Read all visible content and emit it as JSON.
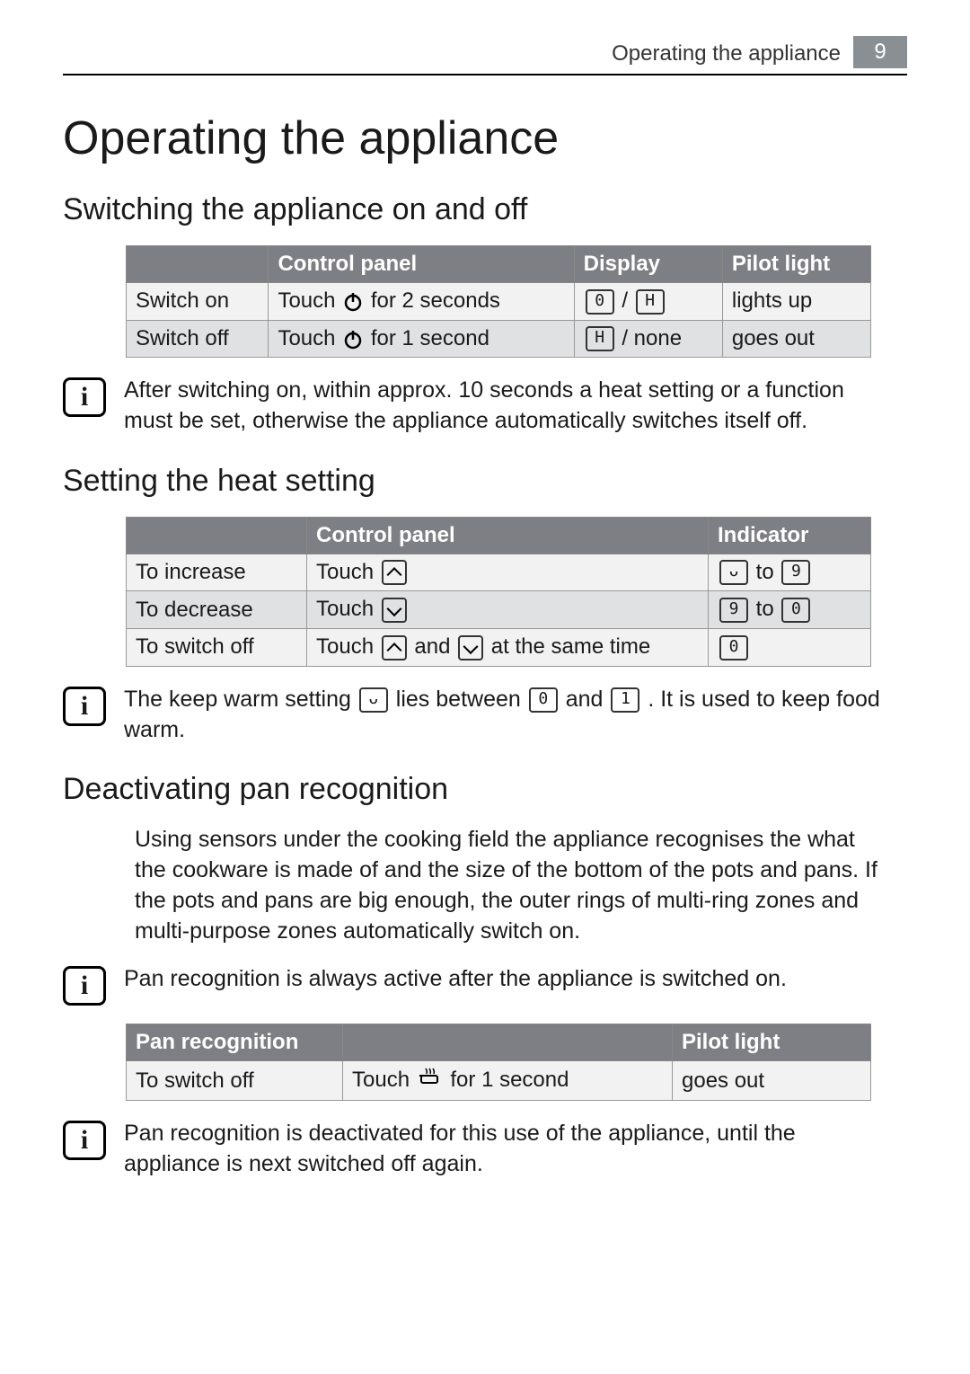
{
  "header": {
    "title": "Operating the appliance",
    "page_number": "9"
  },
  "main_title": "Operating the appliance",
  "section1": {
    "heading": "Switching the appliance on and off",
    "table": {
      "headers": [
        "",
        "Control panel",
        "Display",
        "Pilot light"
      ],
      "rows": [
        {
          "label": "Switch on",
          "control_pre": "Touch ",
          "control_post": " for 2 seconds",
          "display_a": "0",
          "display_sep": " / ",
          "display_b": "H",
          "pilot": "lights up"
        },
        {
          "label": "Switch off",
          "control_pre": "Touch ",
          "control_post": " for 1 second",
          "display_a": "H",
          "display_sep": " / none",
          "display_b": "",
          "pilot": "goes out"
        }
      ]
    },
    "info": "After switching on, within approx. 10 seconds a heat setting or a function must be set, otherwise the appliance automatically switches itself off."
  },
  "section2": {
    "heading": "Setting the heat setting",
    "table": {
      "headers": [
        "",
        "Control panel",
        "Indicator"
      ],
      "rows": [
        {
          "label": "To increase",
          "control_pre": "Touch ",
          "control_mid": "",
          "control_post": "",
          "ind_a": "ᴗ",
          "ind_sep": " to ",
          "ind_b": "9"
        },
        {
          "label": "To decrease",
          "control_pre": "Touch ",
          "control_mid": "",
          "control_post": "",
          "ind_a": "9",
          "ind_sep": " to ",
          "ind_b": "0"
        },
        {
          "label": "To switch off",
          "control_pre": "Touch ",
          "control_mid": " and ",
          "control_post": " at the same time",
          "ind_a": "0",
          "ind_sep": "",
          "ind_b": ""
        }
      ]
    },
    "info_pre": "The keep warm setting ",
    "info_mid1": " lies between ",
    "info_mid2": " and ",
    "info_post": ". It is used to keep food warm.",
    "info_sym_a": "ᴗ",
    "info_sym_b": "0",
    "info_sym_c": "1"
  },
  "section3": {
    "heading": "Deactivating pan recognition",
    "para": "Using sensors under the cooking field the appliance recognises the what the cookware is made of and the size of the bottom of the pots and pans. If the pots and pans are big enough, the outer rings of multi-ring zones and multi-purpose zones automatically switch on.",
    "info1": "Pan recognition is always active after the appliance is switched on.",
    "table": {
      "headers": [
        "Pan recognition",
        "",
        "Pilot light"
      ],
      "rows": [
        {
          "label": "To switch off",
          "control_pre": "Touch ",
          "control_post": " for 1 second",
          "pilot": "goes out"
        }
      ]
    },
    "info2": "Pan recognition is deactivated for this use of the appliance, until the appliance is next switched off again."
  }
}
